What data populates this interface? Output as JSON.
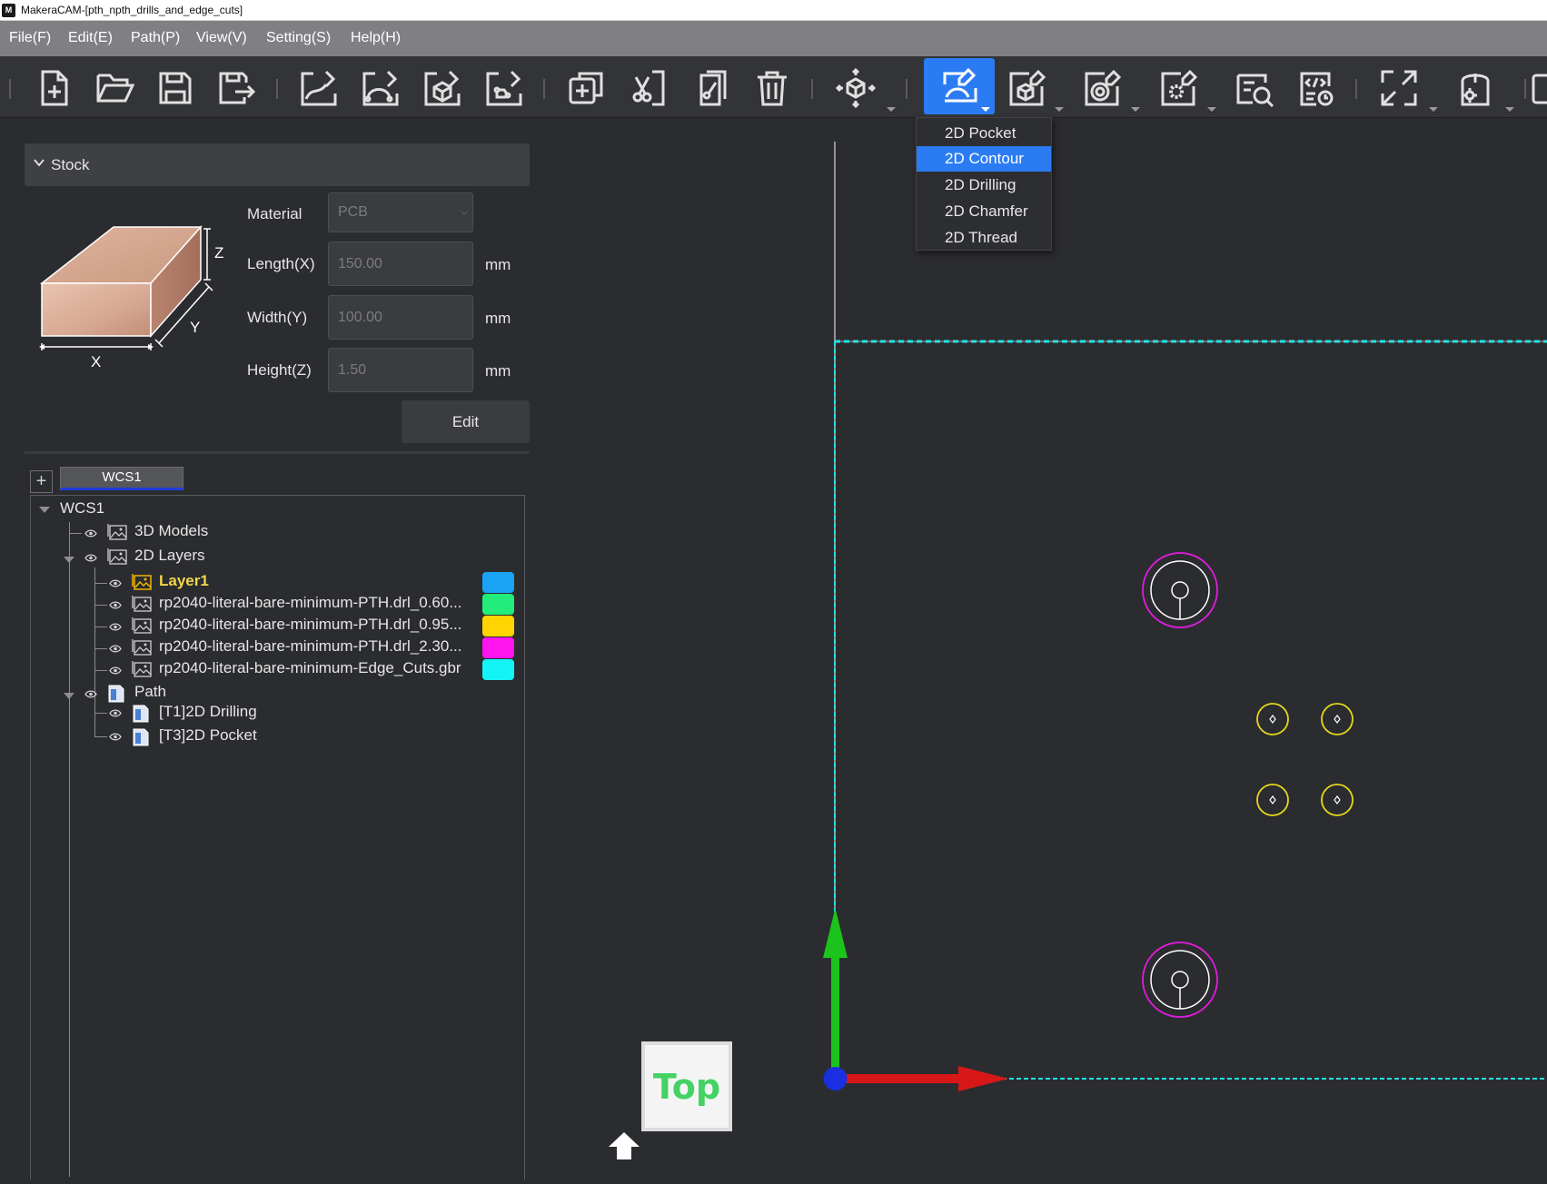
{
  "window": {
    "title": "MakeraCAM-[pth_npth_drills_and_edge_cuts]",
    "logo": "M"
  },
  "menu": {
    "items": [
      "File(F)",
      "Edit(E)",
      "Path(P)",
      "View(V)",
      "Setting(S)",
      "Help(H)"
    ]
  },
  "toolbar": {
    "buttons": [
      "new-file-icon",
      "open-folder-icon",
      "save-icon",
      "save-as-icon",
      "import-2d-icon",
      "import-curve-icon",
      "import-3d-icon",
      "import-pcb-icon",
      "add-box-icon",
      "cut-icon",
      "copy-path-icon",
      "delete-icon",
      "transform-3d-icon",
      "2d-path-icon",
      "3d-path-icon",
      "rotary-path-icon",
      "laser-path-icon",
      "simulate-icon",
      "gcode-icon",
      "fit-view-icon",
      "machine-icon"
    ],
    "active": "2d-path-icon"
  },
  "dropdown": {
    "items": [
      "2D Pocket",
      "2D Contour",
      "2D Drilling",
      "2D Chamfer",
      "2D Thread"
    ],
    "selected": "2D Contour"
  },
  "stock": {
    "header": "Stock",
    "diagram_labels": {
      "x": "X",
      "y": "Y",
      "z": "Z"
    },
    "material": {
      "label": "Material",
      "value": "PCB"
    },
    "length": {
      "label": "Length(X)",
      "value": "150.00",
      "unit": "mm"
    },
    "width": {
      "label": "Width(Y)",
      "value": "100.00",
      "unit": "mm"
    },
    "height": {
      "label": "Height(Z)",
      "value": "1.50",
      "unit": "mm"
    },
    "edit_label": "Edit"
  },
  "wcs_tabs": {
    "add": "+",
    "active": "WCS1"
  },
  "tree": {
    "root": "WCS1",
    "models": "3D Models",
    "layers": "2D Layers",
    "layer_items": [
      {
        "label": "Layer1",
        "color": "#1aa3f5"
      },
      {
        "label": "rp2040-literal-bare-minimum-PTH.drl_0.60...",
        "color": "#22ec7a"
      },
      {
        "label": "rp2040-literal-bare-minimum-PTH.drl_0.95...",
        "color": "#ffd400"
      },
      {
        "label": "rp2040-literal-bare-minimum-PTH.drl_2.30...",
        "color": "#ff14f0"
      },
      {
        "label": "rp2040-literal-bare-minimum-Edge_Cuts.gbr",
        "color": "#14f3f6"
      }
    ],
    "path": "Path",
    "path_items": [
      "[T1]2D Drilling",
      "[T3]2D Pocket"
    ]
  },
  "viewport": {
    "view_cube": "Top",
    "colors": {
      "edge": "#23e2e6",
      "pth_large": "#e21be0",
      "pth_small": "#e7d91a",
      "x_axis": "#d81818",
      "y_axis": "#1cc31c",
      "origin": "#1a2fe0"
    }
  }
}
